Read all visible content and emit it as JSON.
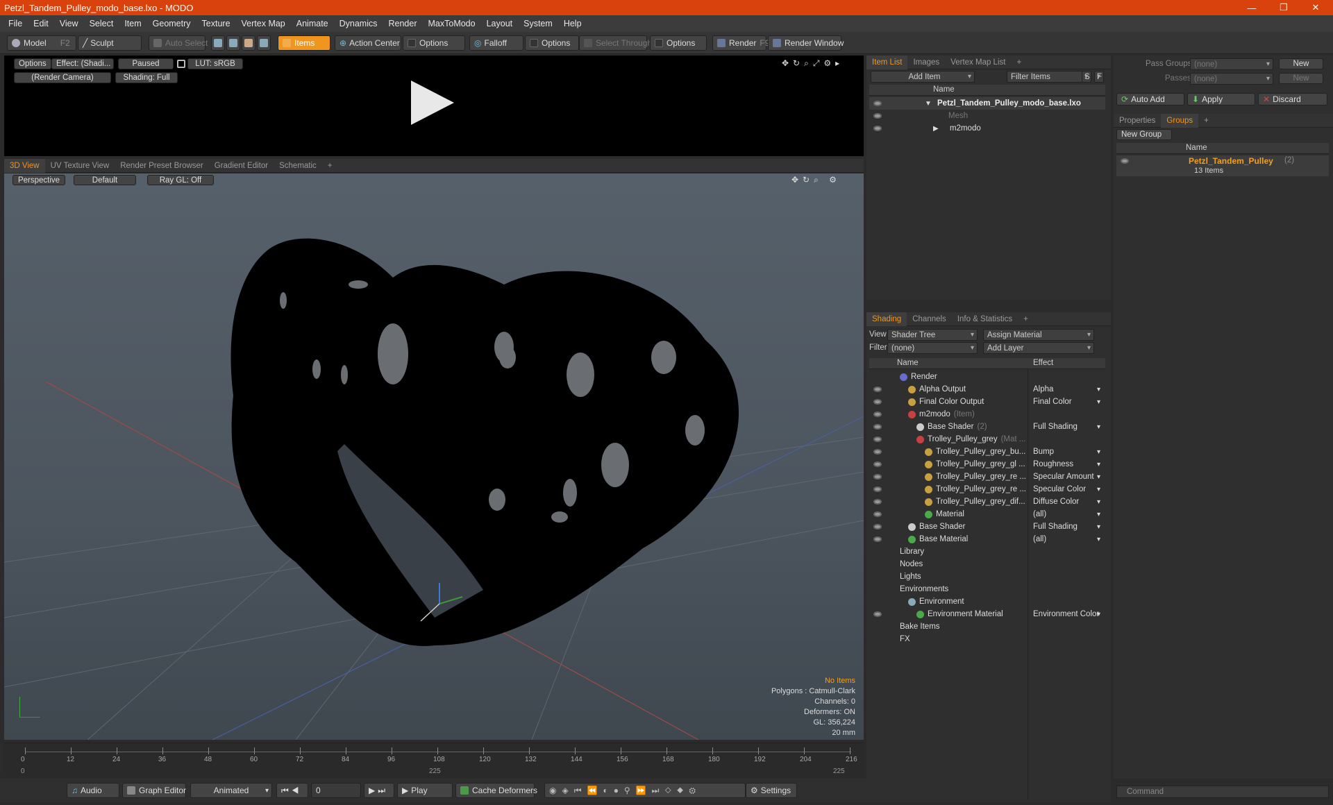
{
  "window": {
    "title": "Petzl_Tandem_Pulley_modo_base.lxo - MODO",
    "minimize": "—",
    "maximize": "❐",
    "close": "✕"
  },
  "menu": [
    "File",
    "Edit",
    "View",
    "Select",
    "Item",
    "Geometry",
    "Texture",
    "Vertex Map",
    "Animate",
    "Dynamics",
    "Render",
    "MaxToModo",
    "Layout",
    "System",
    "Help"
  ],
  "toolbar": {
    "model": "Model",
    "model_key": "F2",
    "sculpt": "Sculpt",
    "auto_select": "Auto Select",
    "items": "Items",
    "action_center": "Action Center",
    "options1": "Options",
    "falloff": "Falloff",
    "options2": "Options",
    "select_through": "Select Through",
    "options3": "Options",
    "render": "Render",
    "render_key": "F9",
    "render_window": "Render Window"
  },
  "preview": {
    "options": "Options",
    "effect": "Effect: (Shadi...",
    "paused": "Paused",
    "lut": "LUT: sRGB",
    "camera": "(Render Camera)",
    "shading": "Shading: Full"
  },
  "viewport": {
    "tabs": [
      "3D View",
      "UV Texture View",
      "Render Preset Browser",
      "Gradient Editor",
      "Schematic",
      "+"
    ],
    "perspective": "Perspective",
    "default": "Default",
    "raygl": "Ray GL: Off",
    "stats": {
      "no_items": "No Items",
      "polygons": "Polygons : Catmull-Clark",
      "channels": "Channels: 0",
      "deformers": "Deformers: ON",
      "gl": "GL: 356,224",
      "size": "20 mm"
    }
  },
  "timeline": {
    "ticks": [
      "0",
      "12",
      "24",
      "36",
      "48",
      "60",
      "72",
      "84",
      "96",
      "108",
      "120",
      "132",
      "144",
      "156",
      "168",
      "180",
      "192",
      "204",
      "216"
    ],
    "start": "0",
    "mid": "225",
    "end": "225"
  },
  "bottom": {
    "audio": "Audio",
    "graph_editor": "Graph Editor",
    "animated": "Animated",
    "frame": "0",
    "play": "Play",
    "cache": "Cache Deformers",
    "settings": "Settings"
  },
  "itemlist": {
    "tabs": [
      "Item List",
      "Images",
      "Vertex Map List",
      "+"
    ],
    "add_item": "Add Item",
    "filter_items": "Filter Items",
    "s": "S",
    "f": "F",
    "col_name": "Name",
    "rows": [
      {
        "label": "Petzl_Tandem_Pulley_modo_base.lxo"
      },
      {
        "label": "Mesh"
      },
      {
        "label": "m2modo"
      }
    ]
  },
  "shading": {
    "tabs": [
      "Shading",
      "Channels",
      "Info & Statistics",
      "+"
    ],
    "view_label": "View",
    "view_value": "Shader Tree",
    "assign": "Assign Material",
    "filter_label": "Filter",
    "filter_value": "(none)",
    "add_layer": "Add Layer",
    "col_name": "Name",
    "col_effect": "Effect",
    "rows": [
      {
        "name": "Render",
        "suffix": "",
        "effect": ""
      },
      {
        "name": "Alpha Output",
        "suffix": "",
        "effect": "Alpha"
      },
      {
        "name": "Final Color Output",
        "suffix": "",
        "effect": "Final Color"
      },
      {
        "name": "m2modo",
        "suffix": "(Item)",
        "effect": ""
      },
      {
        "name": "Base Shader",
        "suffix": "(2)",
        "effect": "Full Shading"
      },
      {
        "name": "Trolley_Pulley_grey",
        "suffix": "(Mat ...",
        "effect": ""
      },
      {
        "name": "Trolley_Pulley_grey_bu...",
        "suffix": "",
        "effect": "Bump"
      },
      {
        "name": "Trolley_Pulley_grey_gl ...",
        "suffix": "",
        "effect": "Roughness"
      },
      {
        "name": "Trolley_Pulley_grey_re ...",
        "suffix": "",
        "effect": "Specular Amount"
      },
      {
        "name": "Trolley_Pulley_grey_re ...",
        "suffix": "",
        "effect": "Specular Color"
      },
      {
        "name": "Trolley_Pulley_grey_dif...",
        "suffix": "",
        "effect": "Diffuse Color"
      },
      {
        "name": "Material",
        "suffix": "",
        "effect": "(all)"
      },
      {
        "name": "Base Shader",
        "suffix": "",
        "effect": "Full Shading"
      },
      {
        "name": "Base Material",
        "suffix": "",
        "effect": "(all)"
      },
      {
        "name": "Library",
        "suffix": "",
        "effect": ""
      },
      {
        "name": "Nodes",
        "suffix": "",
        "effect": ""
      },
      {
        "name": "Lights",
        "suffix": "",
        "effect": ""
      },
      {
        "name": "Environments",
        "suffix": "",
        "effect": ""
      },
      {
        "name": "Environment",
        "suffix": "",
        "effect": ""
      },
      {
        "name": "Environment Material",
        "suffix": "",
        "effect": "Environment Color"
      },
      {
        "name": "Bake Items",
        "suffix": "",
        "effect": ""
      },
      {
        "name": "FX",
        "suffix": "",
        "effect": ""
      }
    ]
  },
  "groups": {
    "pass_groups": "Pass Groups",
    "passes": "Passes",
    "none": "(none)",
    "new": "New",
    "auto_add": "Auto Add",
    "apply": "Apply",
    "discard": "Discard",
    "tabs": [
      "Properties",
      "Groups",
      "+"
    ],
    "new_group": "New Group",
    "col_name": "Name",
    "group_name": "Petzl_Tandem_Pulley",
    "group_count": "(2)",
    "group_items": "13 Items",
    "command": "Command"
  }
}
